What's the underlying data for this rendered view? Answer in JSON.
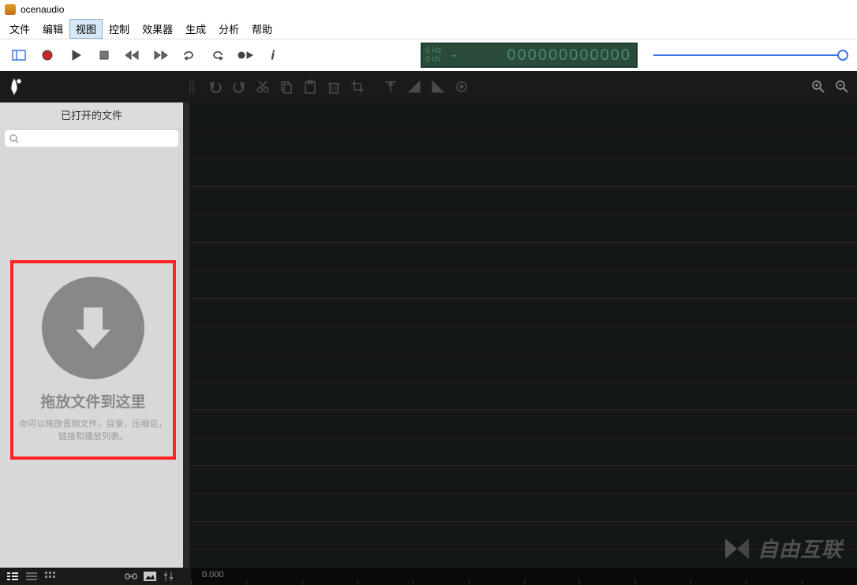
{
  "app": {
    "title": "ocenaudio"
  },
  "menu": {
    "file": "文件",
    "edit": "编辑",
    "view": "视图",
    "control": "控制",
    "effects": "效果器",
    "generate": "生成",
    "analyze": "分析",
    "help": "帮助",
    "active": "view"
  },
  "counter": {
    "hz": "0 Hz",
    "ch": "0 ch",
    "dash": "-",
    "digits": "000000000000"
  },
  "sidebar": {
    "header": "已打开的文件",
    "search_placeholder": ""
  },
  "dropzone": {
    "title": "拖放文件到这里",
    "desc": "你可以拖放音频文件，目录，压缩包，链接和播放列表。"
  },
  "status": {
    "time": "0.000"
  },
  "watermark": {
    "text": "自由互联"
  }
}
